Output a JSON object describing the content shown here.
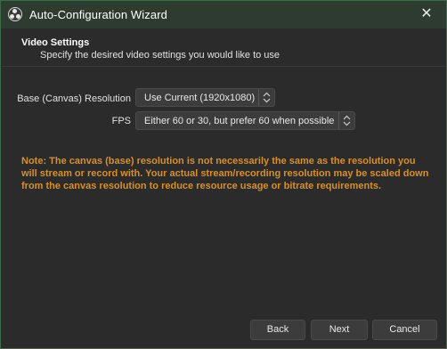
{
  "window": {
    "title": "Auto-Configuration Wizard",
    "close_glyph": "✕",
    "accent_border_color": "#3d6b4a"
  },
  "header": {
    "title": "Video Settings",
    "subtitle": "Specify the desired video settings you would like to use"
  },
  "form": {
    "resolution": {
      "label": "Base (Canvas) Resolution",
      "value": "Use Current (1920x1080)"
    },
    "fps": {
      "label": "FPS",
      "value": "Either 60 or 30, but prefer 60 when possible"
    }
  },
  "note": {
    "text": "Note: The canvas (base) resolution is not necessarily the same as the resolution you will stream or record with. Your actual stream/recording resolution may be scaled down from the canvas resolution to reduce resource usage or bitrate requirements.",
    "color": "#d88f27"
  },
  "buttons": {
    "back": "Back",
    "next": "Next",
    "cancel": "Cancel"
  },
  "icons": {
    "app": "obs-logo-icon",
    "close": "close-icon",
    "combo_arrows": "up-down-chevron-icon"
  }
}
